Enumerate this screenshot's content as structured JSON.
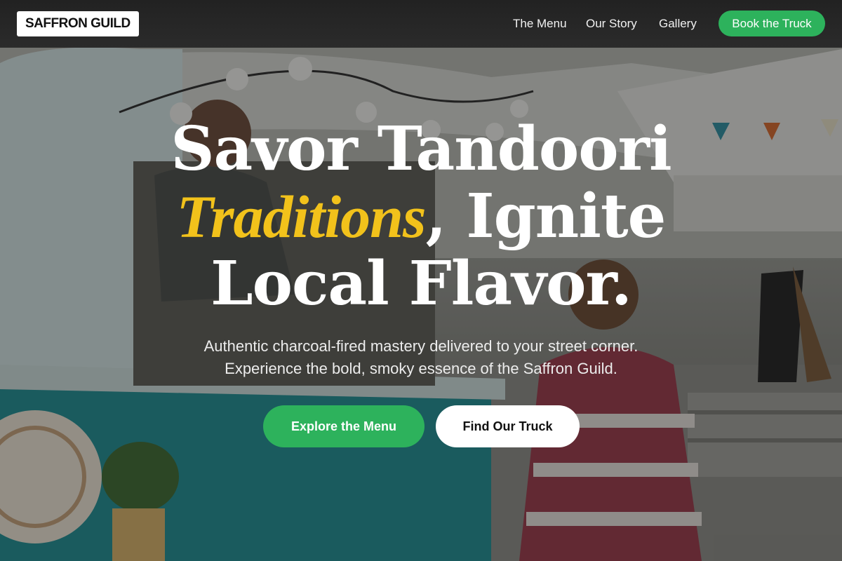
{
  "brand": {
    "logo_text": "SAFFRON GUILD"
  },
  "nav": {
    "links": [
      "The Menu",
      "Our Story",
      "Gallery"
    ],
    "cta_label": "Book the Truck"
  },
  "hero": {
    "headline_line1": "Savor Tandoori",
    "headline_accent": "Traditions",
    "headline_line2_rest": ", Ignite",
    "headline_line3": "Local Flavor.",
    "subtitle_line1": "Authentic charcoal-fired mastery delivered to your street corner.",
    "subtitle_line2": "Experience the bold, smoky essence of the Saffron Guild.",
    "primary_button": "Explore the Menu",
    "secondary_button": "Find Our Truck"
  },
  "colors": {
    "accent_green": "#2db25c",
    "accent_yellow": "#f2c21b",
    "truck_teal": "#1f8f95"
  },
  "background_image": "food-truck-street-market-photo"
}
